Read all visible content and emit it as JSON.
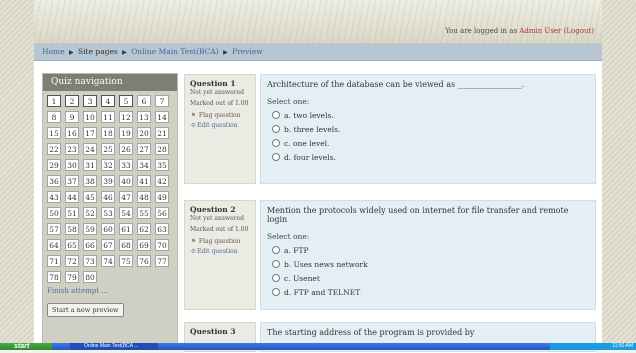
{
  "header": {
    "login_prefix": "You are logged in as ",
    "user_name": "Admin User",
    "logout": "(Logout)"
  },
  "breadcrumb": [
    "Home",
    "Site pages",
    "Online Main Test(BCA)",
    "Preview"
  ],
  "quiz_nav": {
    "title": "Quiz navigation",
    "questions": [
      "1",
      "2",
      "3",
      "4",
      "5",
      "6",
      "7",
      "8",
      "9",
      "10",
      "11",
      "12",
      "13",
      "14",
      "15",
      "16",
      "17",
      "18",
      "19",
      "20",
      "21",
      "22",
      "23",
      "24",
      "25",
      "26",
      "27",
      "28",
      "29",
      "30",
      "31",
      "32",
      "33",
      "34",
      "35",
      "36",
      "37",
      "38",
      "39",
      "40",
      "41",
      "42",
      "43",
      "44",
      "45",
      "46",
      "47",
      "48",
      "49",
      "50",
      "51",
      "52",
      "53",
      "54",
      "55",
      "56",
      "57",
      "58",
      "59",
      "60",
      "61",
      "62",
      "63",
      "64",
      "65",
      "66",
      "67",
      "68",
      "69",
      "70",
      "71",
      "72",
      "73",
      "74",
      "75",
      "76",
      "77",
      "78",
      "79",
      "80"
    ],
    "finish": "Finish attempt ...",
    "start_new": "Start a new preview"
  },
  "questions": [
    {
      "number": "Question 1",
      "state": "Not yet answered",
      "marked": "Marked out of 1.00",
      "flag": "Flag question",
      "edit": "Edit question",
      "text": "Architecture of the database can be viewed as ________________.",
      "select_one": "Select one:",
      "options": [
        "a. two levels.",
        "b. three levels.",
        "c. one level.",
        "d. four levels."
      ]
    },
    {
      "number": "Question 2",
      "state": "Not yet answered",
      "marked": "Marked out of 1.00",
      "flag": "Flag question",
      "edit": "Edit question",
      "text": "Mention the protocols widely used on internet for file transfer and remote login",
      "select_one": "Select one:",
      "options": [
        "a. FTP",
        "b. Uses news network",
        "c. Usenet",
        "d. FTP and TELNET"
      ]
    },
    {
      "number": "Question 3",
      "text": "The starting address of the program is provided by"
    }
  ],
  "taskbar": {
    "start": "start",
    "window": "Online Main Test(BCA ...",
    "clock": "11:50 AM"
  }
}
